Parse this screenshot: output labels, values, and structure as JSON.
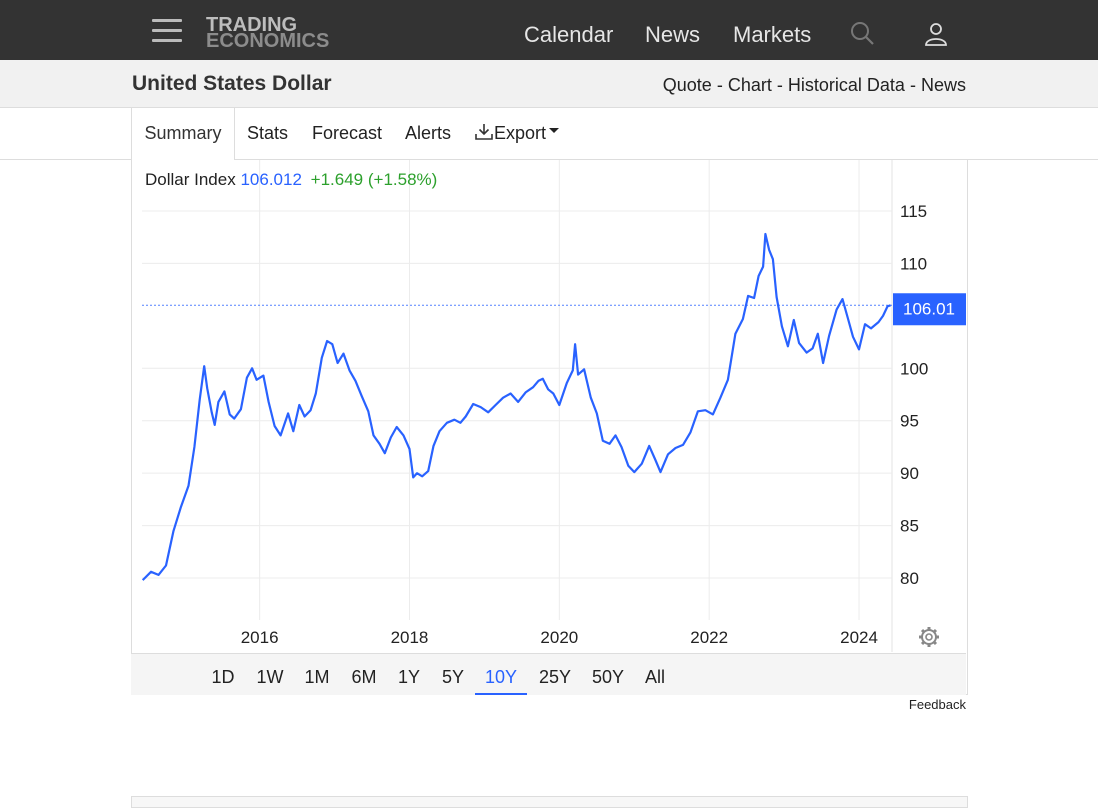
{
  "header": {
    "logo_line1": "TRADING",
    "logo_line2": "ECONOMICS",
    "nav": [
      "Calendar",
      "News",
      "Markets"
    ],
    "icons": [
      "hamburger-icon",
      "search-icon",
      "user-icon"
    ]
  },
  "subheader": {
    "title": "United States Dollar",
    "links": [
      "Quote",
      "Chart",
      "Historical Data",
      "News"
    ],
    "separator": "-"
  },
  "tabs": {
    "summary": "Summary",
    "stats": "Stats",
    "forecast": "Forecast",
    "alerts": "Alerts",
    "export": "Export"
  },
  "quote": {
    "name": "Dollar Index",
    "price": "106.012",
    "change": "+1.649",
    "change_pct": "(+1.58%)",
    "price_tag": "106.01"
  },
  "ranges": [
    "1D",
    "1W",
    "1M",
    "6M",
    "1Y",
    "5Y",
    "10Y",
    "25Y",
    "50Y",
    "All"
  ],
  "active_range": "10Y",
  "feedback": "Feedback",
  "colors": {
    "line": "#2962ff",
    "positive": "#2ca02c",
    "topbar": "#333333"
  },
  "chart_data": {
    "type": "line",
    "title": "",
    "xlabel": "",
    "ylabel": "",
    "x_ticks": [
      "2016",
      "2018",
      "2020",
      "2022",
      "2024"
    ],
    "y_ticks": [
      "80",
      "85",
      "90",
      "95",
      "100",
      "110",
      "115"
    ],
    "ylim": [
      76,
      117
    ],
    "xlim": [
      2014.43,
      2024.44
    ],
    "grid": true,
    "current_value": 106.01,
    "series": [
      {
        "values": [
          [
            2014.44,
            79.8
          ],
          [
            2014.55,
            80.6
          ],
          [
            2014.65,
            80.3
          ],
          [
            2014.75,
            81.2
          ],
          [
            2014.85,
            84.5
          ],
          [
            2014.95,
            86.8
          ],
          [
            2015.05,
            88.8
          ],
          [
            2015.13,
            92.5
          ],
          [
            2015.2,
            97.0
          ],
          [
            2015.26,
            100.2
          ],
          [
            2015.3,
            98.1
          ],
          [
            2015.36,
            95.8
          ],
          [
            2015.4,
            94.6
          ],
          [
            2015.45,
            96.8
          ],
          [
            2015.53,
            97.8
          ],
          [
            2015.6,
            95.6
          ],
          [
            2015.66,
            95.2
          ],
          [
            2015.75,
            96.1
          ],
          [
            2015.83,
            99.1
          ],
          [
            2015.9,
            100.0
          ],
          [
            2015.96,
            98.9
          ],
          [
            2016.05,
            99.3
          ],
          [
            2016.12,
            96.8
          ],
          [
            2016.2,
            94.5
          ],
          [
            2016.28,
            93.6
          ],
          [
            2016.38,
            95.7
          ],
          [
            2016.45,
            94.0
          ],
          [
            2016.53,
            96.5
          ],
          [
            2016.6,
            95.4
          ],
          [
            2016.68,
            96.0
          ],
          [
            2016.75,
            97.6
          ],
          [
            2016.83,
            101.0
          ],
          [
            2016.9,
            102.6
          ],
          [
            2016.97,
            102.3
          ],
          [
            2017.04,
            100.5
          ],
          [
            2017.12,
            101.4
          ],
          [
            2017.2,
            99.8
          ],
          [
            2017.28,
            98.8
          ],
          [
            2017.36,
            97.4
          ],
          [
            2017.45,
            95.9
          ],
          [
            2017.52,
            93.6
          ],
          [
            2017.6,
            92.8
          ],
          [
            2017.67,
            91.9
          ],
          [
            2017.75,
            93.4
          ],
          [
            2017.83,
            94.4
          ],
          [
            2017.92,
            93.6
          ],
          [
            2018.0,
            92.3
          ],
          [
            2018.05,
            89.6
          ],
          [
            2018.1,
            90.0
          ],
          [
            2018.17,
            89.7
          ],
          [
            2018.25,
            90.2
          ],
          [
            2018.32,
            92.6
          ],
          [
            2018.4,
            94.0
          ],
          [
            2018.5,
            94.8
          ],
          [
            2018.6,
            95.1
          ],
          [
            2018.68,
            94.8
          ],
          [
            2018.75,
            95.4
          ],
          [
            2018.85,
            96.6
          ],
          [
            2018.95,
            96.3
          ],
          [
            2019.05,
            95.8
          ],
          [
            2019.15,
            96.5
          ],
          [
            2019.25,
            97.2
          ],
          [
            2019.35,
            97.6
          ],
          [
            2019.45,
            96.8
          ],
          [
            2019.55,
            97.7
          ],
          [
            2019.65,
            98.2
          ],
          [
            2019.72,
            98.8
          ],
          [
            2019.78,
            99.0
          ],
          [
            2019.85,
            98.0
          ],
          [
            2019.92,
            97.6
          ],
          [
            2020.0,
            96.5
          ],
          [
            2020.1,
            98.6
          ],
          [
            2020.18,
            99.8
          ],
          [
            2020.21,
            102.3
          ],
          [
            2020.25,
            99.4
          ],
          [
            2020.33,
            99.9
          ],
          [
            2020.42,
            97.2
          ],
          [
            2020.5,
            95.7
          ],
          [
            2020.58,
            93.1
          ],
          [
            2020.67,
            92.8
          ],
          [
            2020.75,
            93.6
          ],
          [
            2020.83,
            92.5
          ],
          [
            2020.92,
            90.7
          ],
          [
            2021.0,
            90.1
          ],
          [
            2021.1,
            90.9
          ],
          [
            2021.2,
            92.6
          ],
          [
            2021.28,
            91.3
          ],
          [
            2021.35,
            90.1
          ],
          [
            2021.45,
            91.8
          ],
          [
            2021.55,
            92.4
          ],
          [
            2021.65,
            92.7
          ],
          [
            2021.75,
            93.9
          ],
          [
            2021.85,
            95.9
          ],
          [
            2021.95,
            96.0
          ],
          [
            2022.05,
            95.6
          ],
          [
            2022.15,
            97.2
          ],
          [
            2022.25,
            98.9
          ],
          [
            2022.35,
            103.3
          ],
          [
            2022.45,
            104.7
          ],
          [
            2022.52,
            106.9
          ],
          [
            2022.6,
            106.7
          ],
          [
            2022.66,
            108.8
          ],
          [
            2022.72,
            109.7
          ],
          [
            2022.75,
            112.8
          ],
          [
            2022.8,
            111.3
          ],
          [
            2022.85,
            110.4
          ],
          [
            2022.9,
            106.8
          ],
          [
            2022.97,
            104.0
          ],
          [
            2023.05,
            102.1
          ],
          [
            2023.13,
            104.6
          ],
          [
            2023.2,
            102.4
          ],
          [
            2023.3,
            101.5
          ],
          [
            2023.38,
            101.9
          ],
          [
            2023.45,
            103.3
          ],
          [
            2023.52,
            100.5
          ],
          [
            2023.6,
            103.1
          ],
          [
            2023.7,
            105.6
          ],
          [
            2023.78,
            106.6
          ],
          [
            2023.85,
            104.8
          ],
          [
            2023.92,
            103.0
          ],
          [
            2024.0,
            101.8
          ],
          [
            2024.08,
            104.2
          ],
          [
            2024.16,
            103.8
          ],
          [
            2024.26,
            104.4
          ],
          [
            2024.32,
            105.0
          ],
          [
            2024.38,
            105.9
          ],
          [
            2024.42,
            106.01
          ]
        ]
      }
    ]
  }
}
